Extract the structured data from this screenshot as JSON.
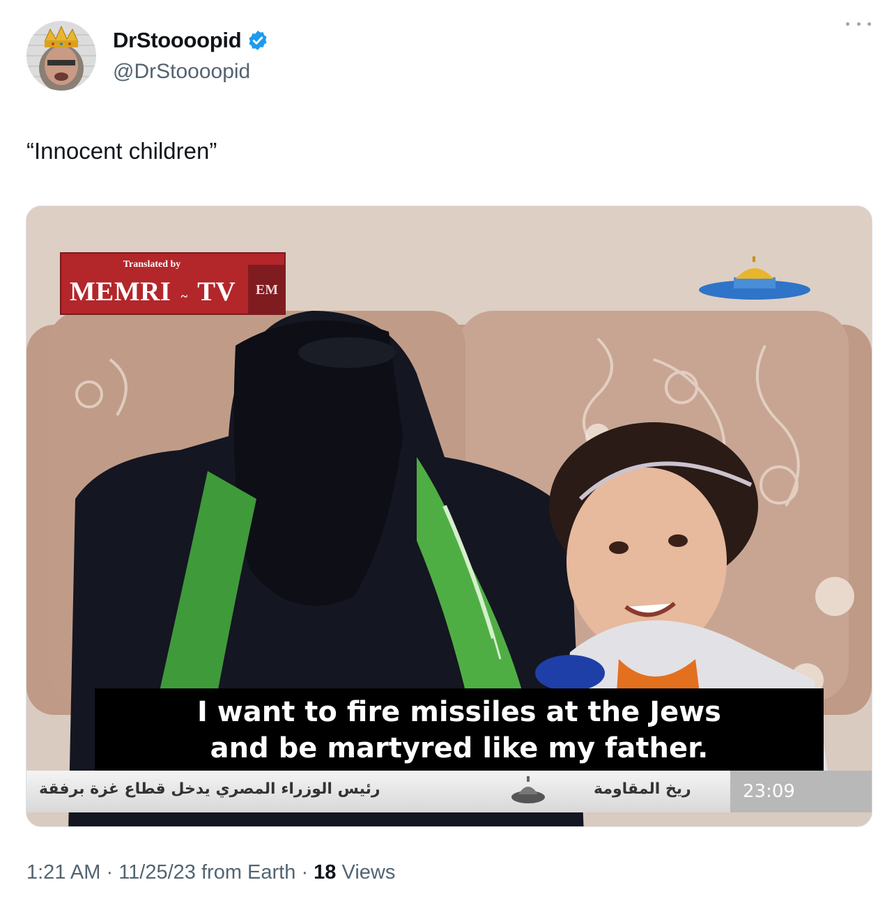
{
  "author": {
    "display_name": "DrStoooopid",
    "handle": "@DrStoooopid",
    "verified": true,
    "avatar_icon": "avatar-crowned-man",
    "verified_color": "#1d9bf0"
  },
  "tweet": {
    "text": "“Innocent children”"
  },
  "media": {
    "badge_translated": "Translated by",
    "badge_logo": "MEMRI",
    "badge_tv": "TV",
    "badge_cube": "ЕМ",
    "subtitle_line1": "I want to fire missiles at the Jews",
    "subtitle_line2": "and be martyred like my father.",
    "ticker_left": "رئيس الوزراء المصري يدخل قطاع غزة برفقة",
    "ticker_mid": "ريخ المقاومة",
    "ticker_time": "23:09"
  },
  "meta": {
    "time": "1:21 AM",
    "separator": "·",
    "date": "11/25/23 from Earth",
    "views_count": "18",
    "views_label": "Views"
  }
}
